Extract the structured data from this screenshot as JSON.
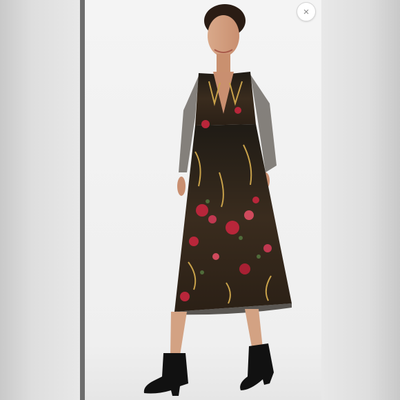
{
  "viewer": {
    "close_symbol": "×",
    "close_icon": "close-icon",
    "background_color": "#e9e9e9",
    "photo_background_color": "#f2f2f2"
  },
  "product": {
    "dress_colors": [
      "#1e1a14",
      "#8a6a3a",
      "#b8263a",
      "#c9a24a",
      "#4f6b3a"
    ],
    "boot_color": "#111111"
  }
}
